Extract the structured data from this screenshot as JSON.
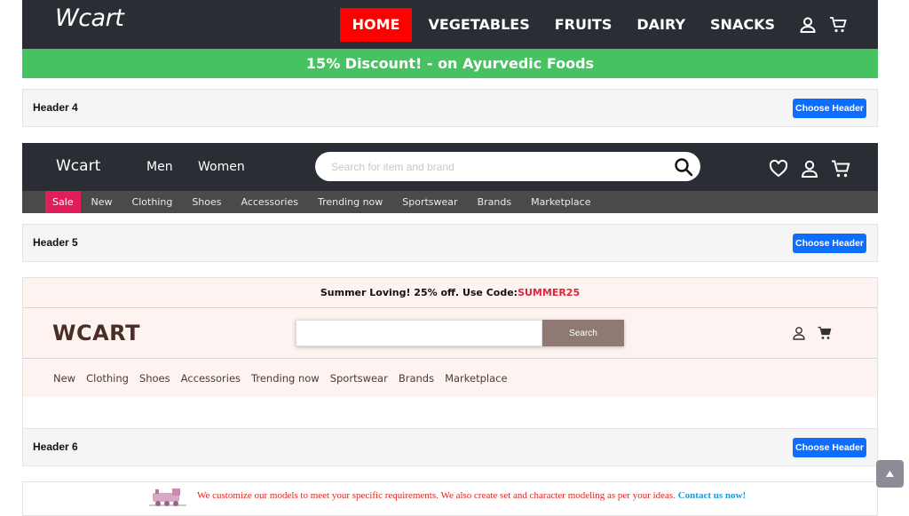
{
  "header4": {
    "logo": "Wcart",
    "menu": [
      "HOME",
      "VEGETABLES",
      "FRUITS",
      "DAIRY",
      "SNACKS"
    ],
    "active_index": 0,
    "icons": [
      "user-icon",
      "cart-icon"
    ],
    "banner": "15% Discount! - on Ayurvedic Foods",
    "accent_color": "#ff0000",
    "banner_color": "#47c261"
  },
  "bar4": {
    "title": "Header 4",
    "button": "Choose Header"
  },
  "header5": {
    "logo": "Wcart",
    "links": [
      "Men",
      "Women"
    ],
    "search_placeholder": "Search for item and brand",
    "icons": [
      "heart-icon",
      "user-icon",
      "cart-icon",
      "search-icon"
    ],
    "sub_menu": [
      "Sale",
      "New",
      "Clothing",
      "Shoes",
      "Accessories",
      "Trending now",
      "Sportswear",
      "Brands",
      "Marketplace"
    ],
    "sale_color": "#e01e5a"
  },
  "bar5": {
    "title": "Header 5",
    "button": "Choose Header"
  },
  "header6": {
    "promo_text": "Summer Loving! 25% off. Use Code:",
    "promo_code": "SUMMER25",
    "logo": "WCART",
    "search_button": "Search",
    "icons": [
      "user-icon",
      "cart-icon"
    ],
    "nav": [
      "New",
      "Clothing",
      "Shoes",
      "Accessories",
      "Trending now",
      "Sportswear",
      "Brands",
      "Marketplace"
    ]
  },
  "bar6": {
    "title": "Header 6",
    "button": "Choose Header"
  },
  "bottom_banner": {
    "text": "We customize our models to meet your specific requirements. We also create set and character modeling as per your ideas.",
    "link": "Contact us now!",
    "image_icon": "train-icon"
  },
  "scroll_top": {
    "icon": "arrow-up-icon"
  }
}
